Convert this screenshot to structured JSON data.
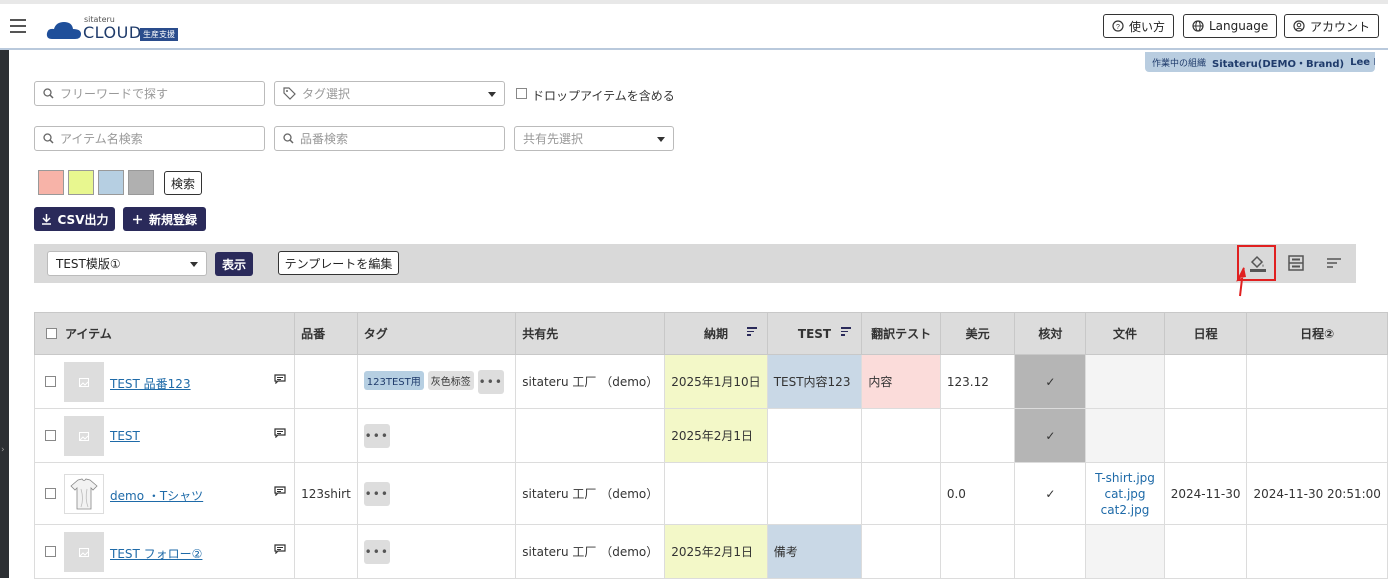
{
  "header": {
    "logo_small": "sitateru",
    "logo_big": "CLOUD",
    "logo_tag": "生産支援",
    "help_label": "使い方",
    "language_label": "Language",
    "account_label": "アカウント"
  },
  "org": {
    "label": "作業中の組織",
    "name": "Sitateru(DEMO・Brand)",
    "user": "Lee B…"
  },
  "filters": {
    "freeword_placeholder": "フリーワードで探す",
    "tag_placeholder": "タグ選択",
    "include_drop_label": "ドロップアイテムを含める",
    "item_name_placeholder": "アイテム名検索",
    "part_no_placeholder": "品番検索",
    "share_placeholder": "共有先選択",
    "search_label": "検索",
    "swatch_colors": [
      "#f7b3a8",
      "#e8f78f",
      "#b6cfe2",
      "#b0b0b0"
    ]
  },
  "actions": {
    "csv_label": "CSV出力",
    "new_label": "新規登録"
  },
  "toolbar": {
    "template_value": "TEST模版①",
    "show_label": "表示",
    "edit_template_label": "テンプレートを編集"
  },
  "table": {
    "headers": [
      "アイテム",
      "品番",
      "タグ",
      "共有先",
      "納期",
      "TEST",
      "翻訳テスト",
      "美元",
      "核対",
      "文件",
      "日程",
      "日程②"
    ],
    "rows": [
      {
        "name": "TEST 品番123",
        "part_no": "",
        "tags": [
          "123TEST用",
          "灰色标签"
        ],
        "share": "sitateru 工厂 （demo）",
        "nouki": "2025年1月10日",
        "test": "TEST内容123",
        "translate": "内容",
        "usd": "123.12",
        "check": "✓",
        "files": [],
        "date": "",
        "date2": ""
      },
      {
        "name": "TEST",
        "part_no": "",
        "tags": [],
        "share": "",
        "nouki": "2025年2月1日",
        "test": "",
        "translate": "",
        "usd": "",
        "check": "✓",
        "files": [],
        "date": "",
        "date2": ""
      },
      {
        "name": "demo ・Tシャツ",
        "part_no": "123shirt",
        "tags": [],
        "share": "sitateru 工厂 （demo）",
        "nouki": "",
        "test": "",
        "translate": "",
        "usd": "0.0",
        "check": "✓",
        "files": [
          "T-shirt.jpg",
          "cat.jpg",
          "cat2.jpg"
        ],
        "date": "2024-11-30",
        "date2": "2024-11-30 20:51:00"
      },
      {
        "name": "TEST フォロー②",
        "part_no": "",
        "tags": [],
        "share": "sitateru 工厂 （demo）",
        "nouki": "2025年2月1日",
        "test": "備考",
        "translate": "",
        "usd": "",
        "check": "",
        "files": [],
        "date": "",
        "date2": ""
      }
    ]
  },
  "more_label": "•••"
}
